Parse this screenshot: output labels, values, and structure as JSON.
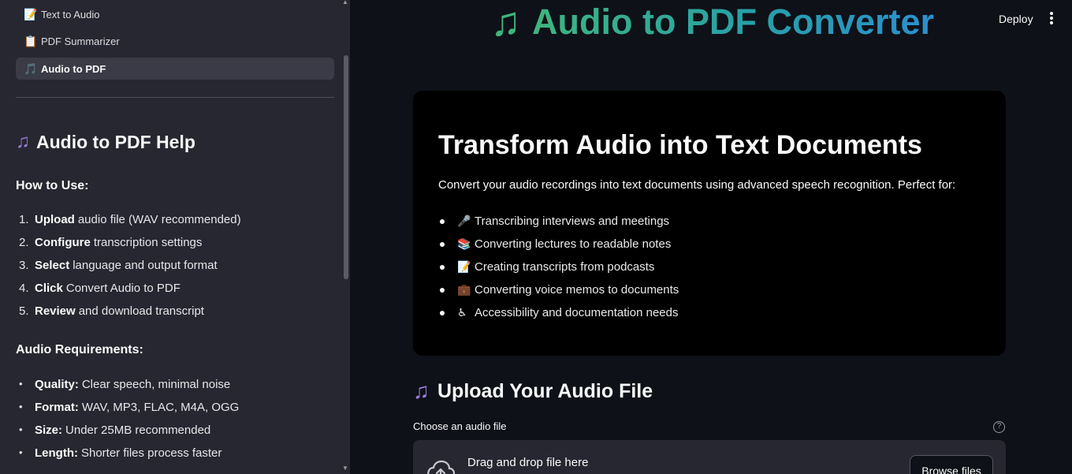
{
  "sidebar": {
    "nav": [
      {
        "icon": "📝",
        "label": "Text to Audio"
      },
      {
        "icon": "📋",
        "label": "PDF Summarizer"
      },
      {
        "icon": "🎵",
        "label": "Audio to PDF",
        "active": true
      }
    ],
    "help_title": "Audio to PDF Help",
    "how_to_use_title": "How to Use:",
    "steps": [
      {
        "num": "1.",
        "bold": "Upload",
        "rest": "audio file (WAV recommended)"
      },
      {
        "num": "2.",
        "bold": "Configure",
        "rest": "transcription settings"
      },
      {
        "num": "3.",
        "bold": "Select",
        "rest": "language and output format"
      },
      {
        "num": "4.",
        "bold": "Click",
        "rest": "Convert Audio to PDF"
      },
      {
        "num": "5.",
        "bold": "Review",
        "rest": "and download transcript"
      }
    ],
    "requirements_title": "Audio Requirements:",
    "requirements": [
      {
        "bold": "Quality:",
        "rest": "Clear speech, minimal noise"
      },
      {
        "bold": "Format:",
        "rest": "WAV, MP3, FLAC, M4A, OGG"
      },
      {
        "bold": "Size:",
        "rest": "Under 25MB recommended"
      },
      {
        "bold": "Length:",
        "rest": "Shorter files process faster"
      }
    ]
  },
  "header": {
    "title_icon": "music-note-icon",
    "title": "Audio to PDF Converter",
    "deploy_label": "Deploy"
  },
  "hero": {
    "heading": "Transform Audio into Text Documents",
    "intro": "Convert your audio recordings into text documents using advanced speech recognition. Perfect for:",
    "items": [
      {
        "emoji": "🎤",
        "text": "Transcribing interviews and meetings"
      },
      {
        "emoji": "📚",
        "text": "Converting lectures to readable notes"
      },
      {
        "emoji": "📝",
        "text": "Creating transcripts from podcasts"
      },
      {
        "emoji": "💼",
        "text": "Converting voice memos to documents"
      },
      {
        "emoji": "♿",
        "text": "Accessibility and documentation needs"
      }
    ]
  },
  "upload": {
    "title": "Upload Your Audio File",
    "field_label": "Choose an audio file",
    "dropzone_text": "Drag and drop file here",
    "browse_label": "Browse files"
  },
  "colors": {
    "background": "#0e1117",
    "sidebar": "#262730",
    "accent_gradient_start": "#3fb57e",
    "accent_gradient_end": "#2b8fd0",
    "hero_card": "#000000"
  }
}
